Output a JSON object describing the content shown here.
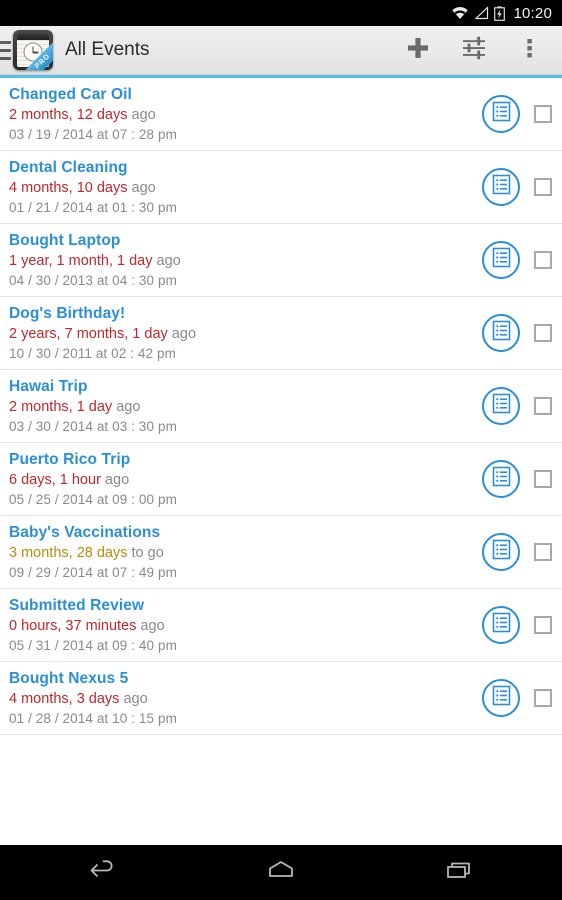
{
  "status_bar": {
    "time": "10:20",
    "icons": [
      "wifi-icon",
      "signal-icon",
      "battery-charging-icon"
    ]
  },
  "action_bar": {
    "drawer_icon": "hamburger-menu-icon",
    "app_icon": "notepad-clock-app-icon",
    "app_icon_badge": "PRO",
    "title": "All Events",
    "actions": [
      {
        "name": "add-event-button",
        "icon": "plus-icon"
      },
      {
        "name": "filter-settings-button",
        "icon": "sliders-icon"
      },
      {
        "name": "overflow-menu-button",
        "icon": "more-vertical-icon"
      }
    ]
  },
  "colors": {
    "accent": "#4fc3e8",
    "title_blue": "#2b8fd8",
    "past_red": "#c1272d",
    "future_gold": "#bb8b0a",
    "muted_gray": "#8a8a8a"
  },
  "list": {
    "note_icon": "list-document-icon",
    "checkbox_icon": "checkbox-unchecked-icon",
    "events": [
      {
        "title": "Changed Car Oil",
        "duration": "2 months, 12 days",
        "suffix": " ago",
        "tense": "past",
        "date": "03 / 19 / 2014 at 07 : 28 pm"
      },
      {
        "title": "Dental Cleaning",
        "duration": "4 months, 10 days",
        "suffix": " ago",
        "tense": "past",
        "date": "01 / 21 / 2014 at 01 : 30 pm"
      },
      {
        "title": "Bought Laptop",
        "duration": "1 year, 1 month, 1 day",
        "suffix": " ago",
        "tense": "past",
        "date": "04 / 30 / 2013 at 04 : 30 pm"
      },
      {
        "title": "Dog's Birthday!",
        "duration": "2 years, 7 months, 1 day",
        "suffix": " ago",
        "tense": "past",
        "date": "10 / 30 / 2011 at 02 : 42 pm"
      },
      {
        "title": "Hawai Trip",
        "duration": "2 months, 1 day",
        "suffix": " ago",
        "tense": "past",
        "date": "03 / 30 / 2014 at 03 : 30 pm"
      },
      {
        "title": "Puerto Rico Trip",
        "duration": "6 days, 1 hour",
        "suffix": " ago",
        "tense": "past",
        "date": "05 / 25 / 2014 at 09 : 00 pm"
      },
      {
        "title": "Baby's Vaccinations",
        "duration": "3 months, 28 days",
        "suffix": " to go",
        "tense": "future",
        "date": "09 / 29 / 2014 at 07 : 49 pm"
      },
      {
        "title": "Submitted Review",
        "duration": "0 hours, 37 minutes",
        "suffix": " ago",
        "tense": "past",
        "date": "05 / 31 / 2014 at 09 : 40 pm"
      },
      {
        "title": "Bought Nexus 5",
        "duration": "4 months, 3 days",
        "suffix": " ago",
        "tense": "past",
        "date": "01 / 28 / 2014 at 10 : 15 pm"
      }
    ]
  },
  "nav_bar": {
    "buttons": [
      {
        "name": "nav-back-button",
        "icon": "back-arrow-icon"
      },
      {
        "name": "nav-home-button",
        "icon": "home-icon"
      },
      {
        "name": "nav-recents-button",
        "icon": "recents-icon"
      }
    ]
  }
}
